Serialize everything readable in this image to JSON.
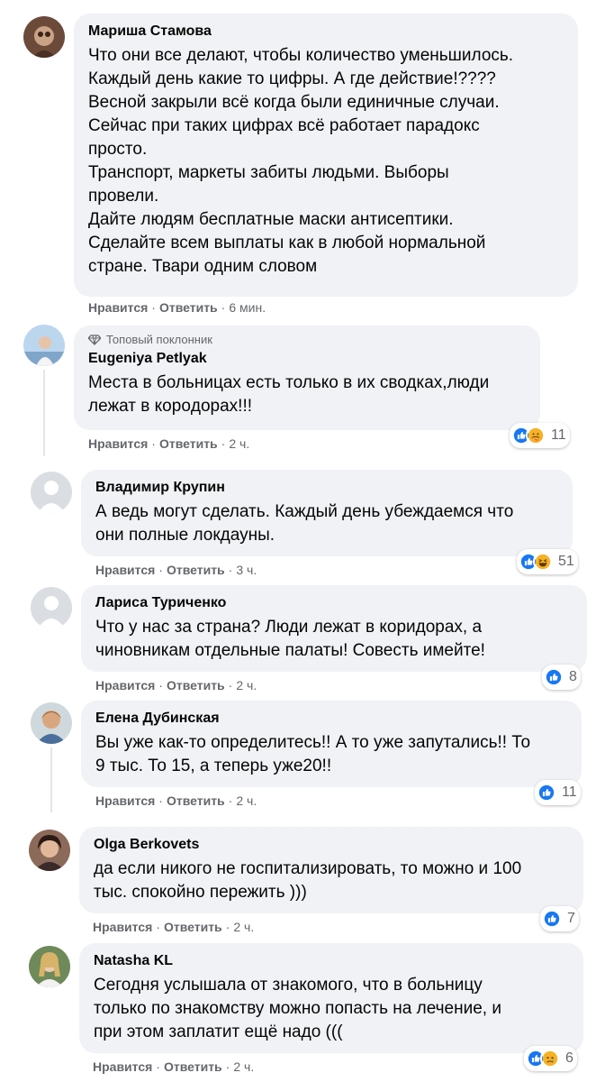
{
  "comments": [
    {
      "author": "Мариша Стамова",
      "text": "Что они все делают, чтобы количество уменьшилось.\nКаждый день какие то цифры. А где действие!????\nВесной закрыли всё когда были единичные случаи.\nСейчас при таких цифрах всё работает парадокс\nпросто.\nТранспорт, маркеты забиты людьми. Выборы\nпровели.\nДайте людям бесплатные маски антисептики.\nСделайте всем выплаты как в любой нормальной\nстране. Твари одним словом",
      "like": "Нравится",
      "reply": "Ответить",
      "time": "6 мин."
    },
    {
      "badge": "Топовый поклонник",
      "author": "Eugeniya Petlyak",
      "text": "Места в больницах есть только в их сводках,люди\nлежат в корoдорах!!!",
      "like": "Нравится",
      "reply": "Ответить",
      "time": "2 ч.",
      "reactions": "11"
    },
    {
      "author": "Владимир Крупин",
      "text": "А ведь могут сделать. Каждый день убеждаемся что\nони полные локдауны.",
      "like": "Нравится",
      "reply": "Ответить",
      "time": "3 ч.",
      "reactions": "51"
    },
    {
      "author": "Лариса Туриченко",
      "text": "Что у нас за страна? Люди лежат в коридорах, а\nчиновникам отдельные палаты! Совесть имейте!",
      "like": "Нравится",
      "reply": "Ответить",
      "time": "2 ч.",
      "reactions": "8"
    },
    {
      "author": "Елена Дубинская",
      "text": "Вы уже как-то определитесь!! А то уже запутались!! То\n9 тыс. То 15, а теперь уже20!!",
      "like": "Нравится",
      "reply": "Ответить",
      "time": "2 ч.",
      "reactions": "11"
    },
    {
      "author": "Olga Berkovets",
      "text": "да если никого не госпитализировать, то можно и 100\nтыс. спокойно пережить )))",
      "like": "Нравится",
      "reply": "Ответить",
      "time": "2 ч.",
      "reactions": "7"
    },
    {
      "author": "Natasha KL",
      "text": "Сегодня услышала от знакомого, что в больницу\nтолько по знакомству можно попасть на лечение, и\nпри этом заплатит ещё надо (((",
      "like": "Нравится",
      "reply": "Ответить",
      "time": "2 ч.",
      "reactions": "6"
    }
  ],
  "colors": {
    "bubble": "#f0f2f5",
    "like_blue": "#1877f2",
    "meta": "#65676b",
    "haha_yellow": "#f7b125"
  }
}
